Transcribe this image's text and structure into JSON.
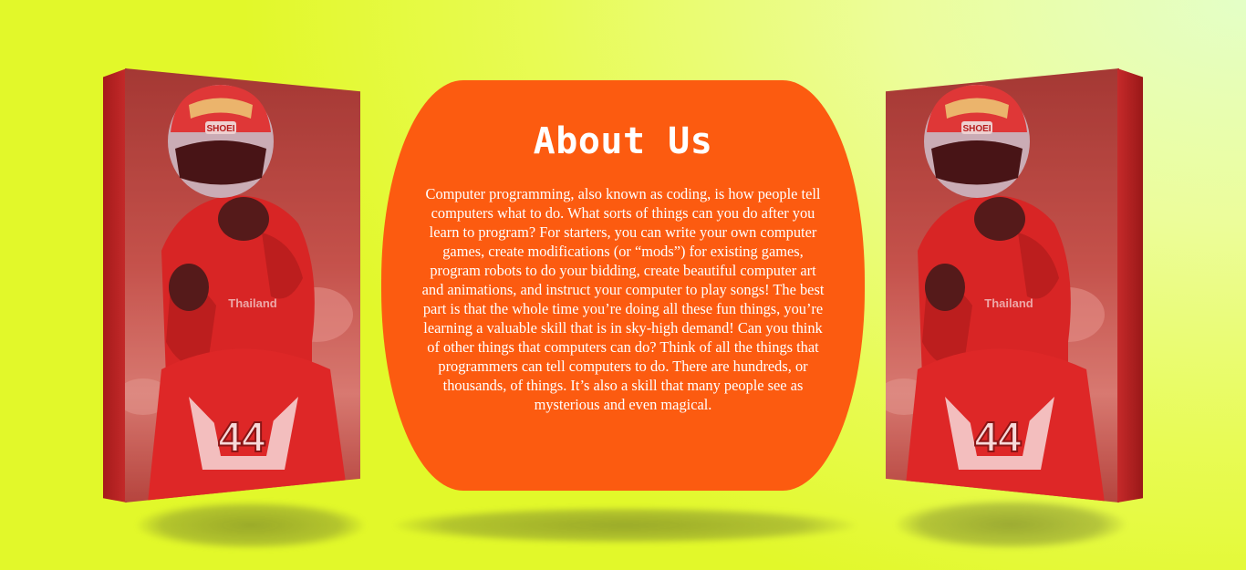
{
  "about": {
    "title": "About Us",
    "body": "Computer programming, also known as coding, is how people tell computers what to do. What sorts of things can you do after you learn to program? For starters, you can write your own computer games, create modifications (or “mods”) for existing games, program robots to do your bidding, create beautiful computer art and animations, and instruct your computer to play songs! The best part is that the whole time you’re doing all these fun things, you’re learning a valuable skill that is in sky-high demand! Can you think of other things that computers can do? Think of all the things that programmers can tell computers to do. There are hundreds, or thousands, of things. It’s also a skill that many people see as mysterious and even magical."
  },
  "images": {
    "left": {
      "icon": "motorcycle-rider-photo",
      "helmet_brand": "SHOEI",
      "race_number": "44",
      "sponsor_text": "Thailand"
    },
    "right": {
      "icon": "motorcycle-rider-photo",
      "helmet_brand": "SHOEI",
      "race_number": "44",
      "sponsor_text": "Thailand"
    }
  },
  "colors": {
    "card": "#fc5b10",
    "book_tint": "#d42a2a",
    "background": "#e8fb55"
  }
}
